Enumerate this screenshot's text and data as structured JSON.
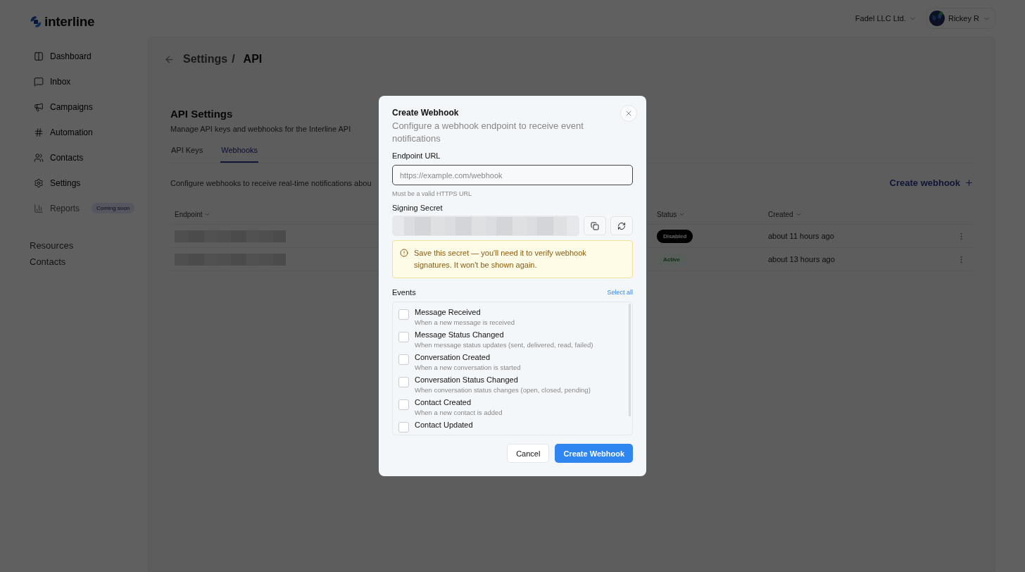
{
  "header": {
    "logo": "interline",
    "org": "Fadel LLC Ltd.",
    "user": "Rickey R"
  },
  "sidebar": {
    "items": [
      {
        "label": "Dashboard",
        "disabled": false
      },
      {
        "label": "Inbox",
        "disabled": false
      },
      {
        "label": "Campaigns",
        "disabled": false
      },
      {
        "label": "Automation",
        "disabled": false
      },
      {
        "label": "Contacts",
        "disabled": false
      },
      {
        "label": "Settings",
        "disabled": false
      },
      {
        "label": "Reports",
        "disabled": true,
        "badge": "Coming soon"
      }
    ],
    "links": [
      "Resources",
      "Contacts"
    ]
  },
  "breadcrumb": {
    "parent": "Settings",
    "separator": "/",
    "current": "API"
  },
  "section": {
    "title": "API Settings",
    "subtitle": "Manage API keys and webhooks for the Interline API"
  },
  "tabs": [
    {
      "label": "API Keys",
      "selected": false
    },
    {
      "label": "Webhooks",
      "selected": true
    }
  ],
  "webhooks": {
    "description": "Configure webhooks to receive real-time notifications abou",
    "create_label": "Create webhook",
    "columns": [
      "Endpoint",
      "Status",
      "Created"
    ],
    "rows": [
      {
        "active": false,
        "status": "Disabled",
        "created": "about 11 hours ago"
      },
      {
        "active": true,
        "status": "Active",
        "created": "about 13 hours ago"
      }
    ]
  },
  "dialog": {
    "title": "Create Webhook",
    "description": "Configure a webhook endpoint to receive event notifications",
    "endpoint_label": "Endpoint URL",
    "endpoint_placeholder": "https://example.com/webhook",
    "endpoint_hint": "Must be a valid HTTPS URL",
    "secret_label": "Signing Secret",
    "warning": "Save this secret — you'll need it to verify webhook signatures. It won't be shown again.",
    "events_label": "Events",
    "select_all": "Select all",
    "events": [
      {
        "name": "Message Received",
        "description": "When a new message is received",
        "checked": false
      },
      {
        "name": "Message Status Changed",
        "description": "When message status updates (sent, delivered, read, failed)",
        "checked": false
      },
      {
        "name": "Conversation Created",
        "description": "When a new conversation is started",
        "checked": false
      },
      {
        "name": "Conversation Status Changed",
        "description": "When conversation status changes (open, closed, pending)",
        "checked": false
      },
      {
        "name": "Contact Created",
        "description": "When a new contact is added",
        "checked": false
      },
      {
        "name": "Contact Updated",
        "checked": false
      }
    ],
    "cancel": "Cancel",
    "submit": "Create Webhook"
  }
}
